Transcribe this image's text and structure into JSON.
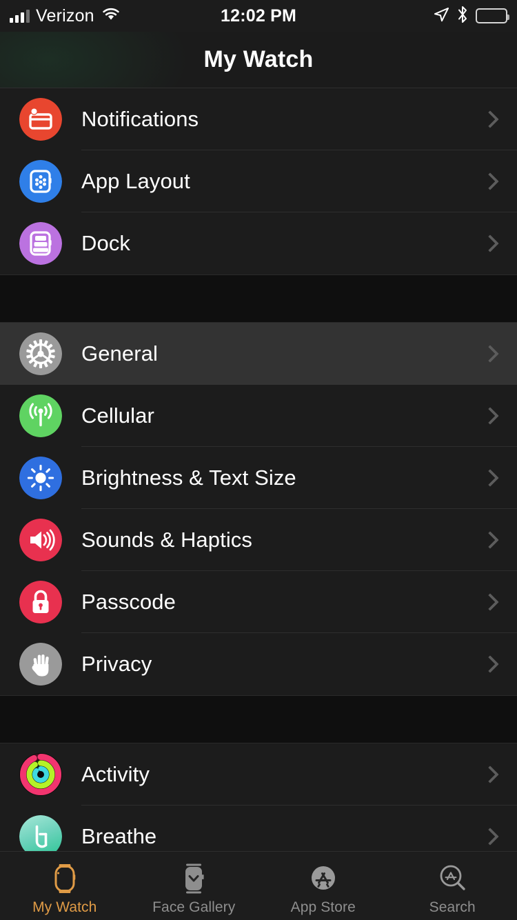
{
  "status_bar": {
    "carrier": "Verizon",
    "signal_icon": "cellular-signal-icon",
    "wifi_icon": "wifi-icon",
    "time": "12:02 PM",
    "location_icon": "location-arrow-icon",
    "bluetooth_icon": "bluetooth-icon",
    "battery_icon": "battery-icon"
  },
  "nav": {
    "title": "My Watch"
  },
  "colors": {
    "accent": "#e09b46",
    "page_background": "#1c1c1c",
    "row_highlight": "#333333",
    "separator": "#2e2e2e",
    "chevron": "#5c5c5c",
    "tab_inactive": "#8e8e8e"
  },
  "list": {
    "sections": [
      {
        "rows": [
          {
            "label": "Notifications",
            "icon": "notifications-icon",
            "icon_color": "#e8462f",
            "chevron": true,
            "highlighted": false
          },
          {
            "label": "App Layout",
            "icon": "app-layout-icon",
            "icon_color": "#2f7fe8",
            "chevron": true,
            "highlighted": false
          },
          {
            "label": "Dock",
            "icon": "dock-icon",
            "icon_color": "#b濃",
            "chevron": true,
            "highlighted": false
          }
        ]
      },
      {
        "rows": [
          {
            "label": "General",
            "icon": "gear-icon",
            "icon_color": "#9a9a9a",
            "chevron": true,
            "highlighted": true
          },
          {
            "label": "Cellular",
            "icon": "cellular-icon",
            "icon_color": "#5fd362",
            "chevron": true,
            "highlighted": false
          },
          {
            "label": "Brightness & Text Size",
            "icon": "brightness-icon",
            "icon_color": "#2f6fe0",
            "chevron": true,
            "highlighted": false
          },
          {
            "label": "Sounds & Haptics",
            "icon": "sounds-icon",
            "icon_color": "#e8314f",
            "chevron": true,
            "highlighted": false
          },
          {
            "label": "Passcode",
            "icon": "lock-icon",
            "icon_color": "#e8314f",
            "chevron": true,
            "highlighted": false
          },
          {
            "label": "Privacy",
            "icon": "hand-icon",
            "icon_color": "#9a9a9a",
            "chevron": true,
            "highlighted": false
          }
        ]
      },
      {
        "rows": [
          {
            "label": "Activity",
            "icon": "activity-rings-icon",
            "icon_color": "#f2356f",
            "chevron": true,
            "highlighted": false
          },
          {
            "label": "Breathe",
            "icon": "breathe-icon",
            "icon_color": "#72d8bd",
            "chevron": true,
            "highlighted": false
          }
        ]
      }
    ]
  },
  "tab_bar": {
    "tabs": [
      {
        "label": "My Watch",
        "icon": "watch-icon",
        "active": true
      },
      {
        "label": "Face Gallery",
        "icon": "watch-face-icon",
        "active": false
      },
      {
        "label": "App Store",
        "icon": "app-store-icon",
        "active": false
      },
      {
        "label": "Search",
        "icon": "search-icon",
        "active": false
      }
    ]
  }
}
